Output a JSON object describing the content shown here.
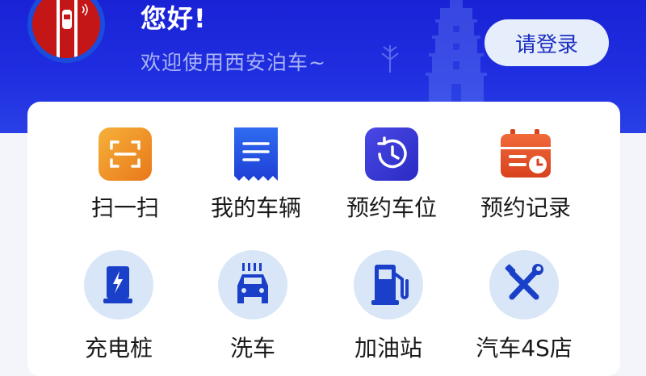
{
  "header": {
    "greeting": "您好!",
    "welcome": "欢迎使用西安泊车~",
    "login_label": "请登录",
    "bg_color": "#1f2ee0"
  },
  "services": {
    "row1": [
      {
        "label": "扫一扫",
        "icon": "scan-icon",
        "color": "#f0941c"
      },
      {
        "label": "我的车辆",
        "icon": "vehicle-doc-icon",
        "color": "#2a52e8"
      },
      {
        "label": "预约车位",
        "icon": "history-clock-icon",
        "color": "#3a3fd8"
      },
      {
        "label": "预约记录",
        "icon": "calendar-clock-icon",
        "color": "#e8542a"
      }
    ],
    "row2": [
      {
        "label": "充电桩",
        "icon": "charging-pile-icon",
        "color": "#1a3fc8"
      },
      {
        "label": "洗车",
        "icon": "car-wash-icon",
        "color": "#1a3fc8"
      },
      {
        "label": "加油站",
        "icon": "gas-station-icon",
        "color": "#1a3fc8"
      },
      {
        "label": "汽车4S店",
        "icon": "tools-icon",
        "color": "#1a3fc8"
      }
    ]
  }
}
